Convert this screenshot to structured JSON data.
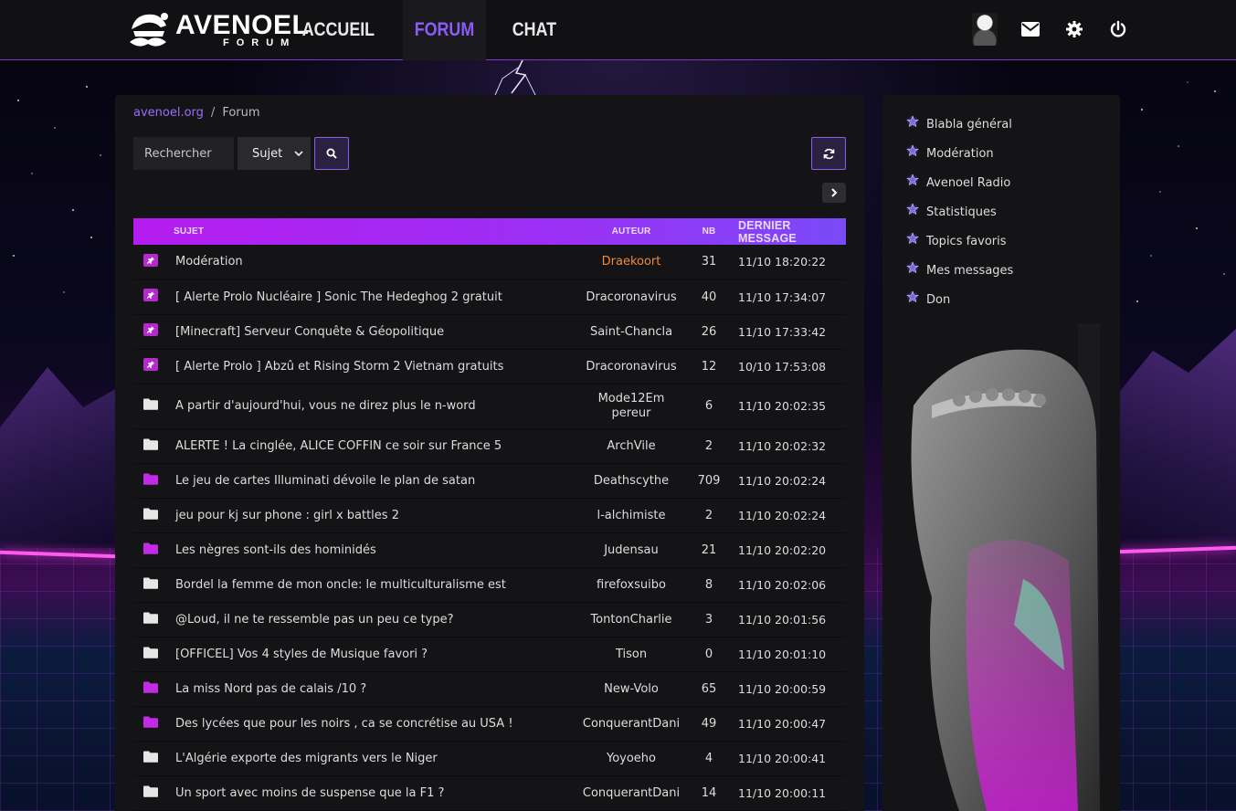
{
  "brand": {
    "name": "AVENOEL",
    "sub": "FORUM"
  },
  "nav": [
    {
      "label": "ACCUEIL",
      "active": false
    },
    {
      "label": "FORUM",
      "active": true
    },
    {
      "label": "CHAT",
      "active": false
    }
  ],
  "top_icons": [
    "avatar",
    "mail-icon",
    "gear-icon",
    "power-icon"
  ],
  "breadcrumb": {
    "home": "avenoel.org",
    "sep": "/",
    "current": "Forum"
  },
  "search": {
    "placeholder": "Rechercher",
    "select_value": "Sujet"
  },
  "table": {
    "headers": {
      "subject": "SUJET",
      "author": "AUTEUR",
      "count": "NB",
      "last": "DERNIER MESSAGE"
    },
    "rows": [
      {
        "icon": "pin",
        "subject": "Modération",
        "author": "Draekoort",
        "author_color": "orange",
        "nb": "31",
        "date": "11/10 18:20:22"
      },
      {
        "icon": "pin",
        "subject": "[ Alerte Prolo Nucléaire ] Sonic The Hedeghog 2 gratuit",
        "author": "Dracoronavirus",
        "nb": "40",
        "date": "11/10 17:34:07"
      },
      {
        "icon": "pin",
        "subject": "[Minecraft] Serveur Conquête & Géopolitique",
        "author": "Saint-Chancla",
        "nb": "26",
        "date": "11/10 17:33:42"
      },
      {
        "icon": "pin",
        "subject": "[ Alerte Prolo ] Abzû et Rising Storm 2 Vietnam gratuits",
        "author": "Dracoronavirus",
        "nb": "12",
        "date": "10/10 17:53:08"
      },
      {
        "icon": "folder",
        "subject": "A partir d'aujourd'hui, vous ne direz plus le n-word",
        "author": "Mode12Empereur",
        "nb": "6",
        "date": "11/10 20:02:35",
        "tall": true
      },
      {
        "icon": "folder",
        "subject": "ALERTE ! La cinglée, ALICE COFFIN ce soir sur France 5",
        "author": "ArchVile",
        "nb": "2",
        "date": "11/10 20:02:32"
      },
      {
        "icon": "folder-hot",
        "subject": "Le jeu de cartes Illuminati dévoile le plan de satan",
        "author": "Deathscythe",
        "nb": "709",
        "date": "11/10 20:02:24"
      },
      {
        "icon": "folder",
        "subject": "jeu pour kj sur phone : girl x battles 2",
        "author": "l-alchimiste",
        "nb": "2",
        "date": "11/10 20:02:24"
      },
      {
        "icon": "folder-hot",
        "subject": "Les nègres sont-ils des hominidés",
        "author": "Judensau",
        "nb": "21",
        "date": "11/10 20:02:20"
      },
      {
        "icon": "folder",
        "subject": "Bordel la femme de mon oncle: le multiculturalisme est",
        "author": "firefoxsuibo",
        "nb": "8",
        "date": "11/10 20:02:06"
      },
      {
        "icon": "folder",
        "subject": "@Loud, il ne te ressemble pas un peu ce type?",
        "author": "TontonCharlie",
        "nb": "3",
        "date": "11/10 20:01:56"
      },
      {
        "icon": "folder",
        "subject": "[OFFICEL] Vos 4 styles de Musique favori ?",
        "author": "Tison",
        "nb": "0",
        "date": "11/10 20:01:10"
      },
      {
        "icon": "folder-hot",
        "subject": "La miss Nord pas de calais /10 ?",
        "author": "New-Volo",
        "nb": "65",
        "date": "11/10 20:00:59"
      },
      {
        "icon": "folder-hot",
        "subject": "Des lycées que pour les noirs , ca se concrétise au USA !",
        "author": "ConquerantDani",
        "nb": "49",
        "date": "11/10 20:00:47"
      },
      {
        "icon": "folder",
        "subject": "L'Algérie exporte des migrants vers le Niger",
        "author": "Yoyoeho",
        "nb": "4",
        "date": "11/10 20:00:41"
      },
      {
        "icon": "folder",
        "subject": "Un sport avec moins de suspense que la F1 ?",
        "author": "ConquerantDani",
        "nb": "14",
        "date": "11/10 20:00:11"
      }
    ]
  },
  "sidebar": {
    "items": [
      {
        "label": "Blabla général"
      },
      {
        "label": "Modération"
      },
      {
        "label": "Avenoel Radio"
      },
      {
        "label": "Statistiques"
      },
      {
        "label": "Topics favoris"
      },
      {
        "label": "Mes messages"
      },
      {
        "label": "Don"
      }
    ]
  },
  "colors": {
    "accent": "#8b5cf6",
    "header_gradient_start": "#b51cf0",
    "pin": "#b629cc",
    "orange_author": "#f08a3c"
  }
}
